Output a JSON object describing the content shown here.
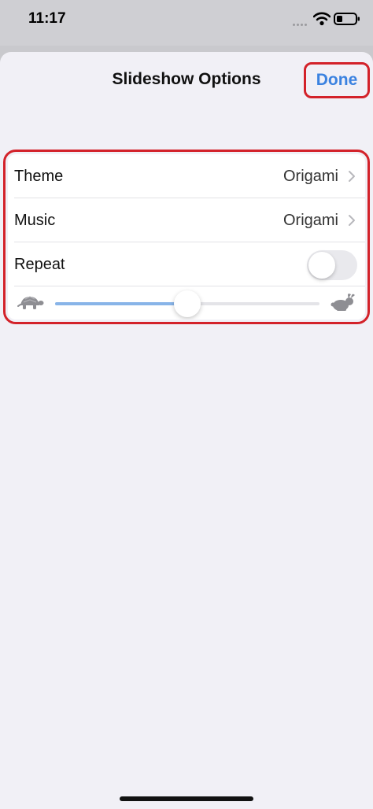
{
  "status_bar": {
    "time": "11:17",
    "icons": [
      "wifi-icon",
      "battery-icon"
    ]
  },
  "nav": {
    "title": "Slideshow Options",
    "done_label": "Done"
  },
  "options": {
    "theme": {
      "label": "Theme",
      "value": "Origami"
    },
    "music": {
      "label": "Music",
      "value": "Origami"
    },
    "repeat": {
      "label": "Repeat",
      "enabled": false
    },
    "speed": {
      "value": 0.5,
      "min_icon": "turtle-icon",
      "max_icon": "rabbit-icon"
    }
  },
  "colors": {
    "accent": "#3b82e0",
    "highlight": "#d3222a",
    "slider_fill": "#88b4e8"
  }
}
